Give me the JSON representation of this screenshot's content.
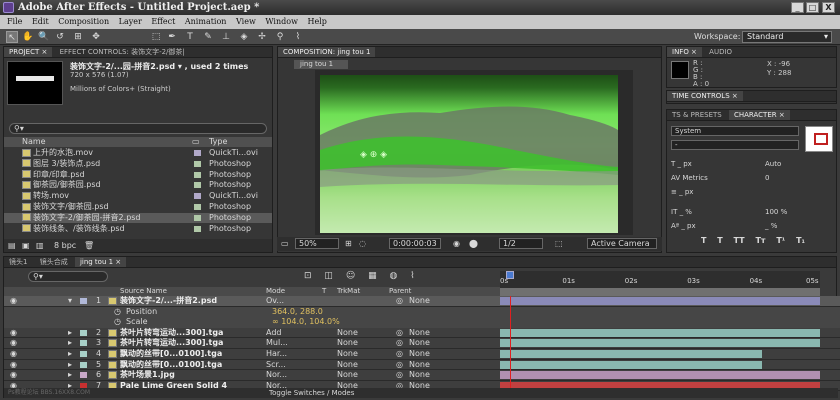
{
  "app": {
    "title": "Adobe After Effects - Untitled Project.aep *",
    "win_min": "_",
    "win_max": "□",
    "win_close": "X"
  },
  "menu": [
    "File",
    "Edit",
    "Composition",
    "Layer",
    "Effect",
    "Animation",
    "View",
    "Window",
    "Help"
  ],
  "toolbar": {
    "tools": [
      "↖",
      "✋",
      "🔍",
      "↺",
      "⊞",
      "✥",
      "⬚",
      "✒",
      "T",
      "✎",
      "⊥",
      "◈",
      "✢",
      "⚲",
      "⌇"
    ],
    "workspace_label": "Workspace:",
    "workspace_value": "Standard"
  },
  "project": {
    "tab_project": "PROJECT ×",
    "tab_effects": "EFFECT CONTROLS: 装饰文字-2/御茶|",
    "selected_name": "装饰文字-2/...园-拼音2.psd ▾ , used 2 times",
    "selected_dims": "720 x 576 (1.07)",
    "selected_colors": "Millions of Colors+ (Straight)",
    "search_placeholder": "",
    "col_name": "Name",
    "col_type": "Type",
    "items": [
      {
        "name": "上升的水泡.mov",
        "type": "QuickTi...ovi",
        "color": "#b0a8c8"
      },
      {
        "name": "图层 3/装饰点.psd",
        "type": "Photoshop",
        "color": "#b0c8a8"
      },
      {
        "name": "印章/印章.psd",
        "type": "Photoshop",
        "color": "#b0c8a8"
      },
      {
        "name": "御茶园/御茶园.psd",
        "type": "Photoshop",
        "color": "#b0c8a8"
      },
      {
        "name": "转场.mov",
        "type": "QuickTi...ovi",
        "color": "#b0a8c8"
      },
      {
        "name": "装饰文字/御茶园.psd",
        "type": "Photoshop",
        "color": "#b0c8a8"
      },
      {
        "name": "装饰文字-2/御茶园-拼音2.psd",
        "type": "Photoshop",
        "color": "#b0c8a8"
      },
      {
        "name": "装饰线条、/装饰线条.psd",
        "type": "Photoshop",
        "color": "#b0c8a8"
      }
    ],
    "bpc": "8 bpc"
  },
  "composition": {
    "tab_label": "COMPOSITION: jing tou 1",
    "view_tab": "jing tou 1",
    "zoom": "50%",
    "timecode": "0:00:00:03",
    "resolution": "1/2",
    "camera": "Active Camera",
    "image_text": "◈ ⊕ ◈"
  },
  "info": {
    "tab_info": "INFO ×",
    "tab_audio": "AUDIO",
    "r": "R :",
    "g": "G :",
    "b": "B :",
    "a": "A : 0",
    "x": "X : -96",
    "y": "Y : 288"
  },
  "time_controls": {
    "label": "TIME CONTROLS ×"
  },
  "character": {
    "tab_presets": "TS & PRESETS",
    "tab_character": "CHARACTER ×",
    "font": "System",
    "style": "-",
    "size": "_ px",
    "leading": "Auto",
    "kerning": "Metrics",
    "tracking": "0",
    "stroke": "_ px",
    "vscale": "_ %",
    "hscale": "100 %",
    "baseline": "_ px",
    "tsume": "_ %",
    "styles": [
      "T",
      "T",
      "TT",
      "Tт",
      "T¹",
      "T₁"
    ]
  },
  "timeline": {
    "tabs": [
      "镜头1",
      "镜头合成",
      "jing tou 1 ×"
    ],
    "search_placeholder": "",
    "headers": {
      "source": "Source Name",
      "mode": "Mode",
      "t": "T",
      "trkmat": "TrkMat",
      "parent": "Parent"
    },
    "ruler": [
      "0s",
      "01s",
      "02s",
      "03s",
      "04s",
      "05s"
    ],
    "current_time_fraction": 0.02,
    "layers": [
      {
        "num": "1",
        "name": "装饰文字-2/...-拼音2.psd",
        "mode": "Ov...",
        "trk": "",
        "parent": "None",
        "color": "#b0b8d8",
        "bar": "#8a8ab8",
        "bar_start": 0.0,
        "bar_end": 1.0
      },
      {
        "num": "2",
        "name": "茶叶片转弯运动...300].tga",
        "mode": "Add",
        "trk": "None",
        "parent": "None",
        "color": "#a8d0c8",
        "bar": "#8ab8b0",
        "bar_start": 0.0,
        "bar_end": 1.0
      },
      {
        "num": "3",
        "name": "茶叶片转弯运动...300].tga",
        "mode": "Mul...",
        "trk": "None",
        "parent": "None",
        "color": "#a8d0c8",
        "bar": "#8ab8b0",
        "bar_start": 0.0,
        "bar_end": 1.0
      },
      {
        "num": "4",
        "name": "飘动的丝带[0...0100].tga",
        "mode": "Har...",
        "trk": "None",
        "parent": "None",
        "color": "#a8d0c8",
        "bar": "#8ab8b0",
        "bar_start": 0.0,
        "bar_end": 0.82
      },
      {
        "num": "5",
        "name": "飘动的丝带[0...0100].tga",
        "mode": "Scr...",
        "trk": "None",
        "parent": "None",
        "color": "#a8d0c8",
        "bar": "#8ab8b0",
        "bar_start": 0.0,
        "bar_end": 0.82
      },
      {
        "num": "6",
        "name": "茶叶场景1.jpg",
        "mode": "Nor...",
        "trk": "None",
        "parent": "None",
        "color": "#c8a8c8",
        "bar": "#b090b0",
        "bar_start": 0.0,
        "bar_end": 1.0
      },
      {
        "num": "7",
        "name": "Pale Lime Green Solid 4",
        "mode": "Nor...",
        "trk": "None",
        "parent": "None",
        "color": "#c83030",
        "bar": "#c04040",
        "bar_start": 0.0,
        "bar_end": 1.0
      }
    ],
    "position_label": "Position",
    "position_value": "364.0, 288.0",
    "scale_label": "Scale",
    "scale_value": "∞ 104.0, 104.0%",
    "toggle_label": "Toggle Switches / Modes",
    "watermark": "Ps教程论坛 BBS.16XX8.COM"
  }
}
